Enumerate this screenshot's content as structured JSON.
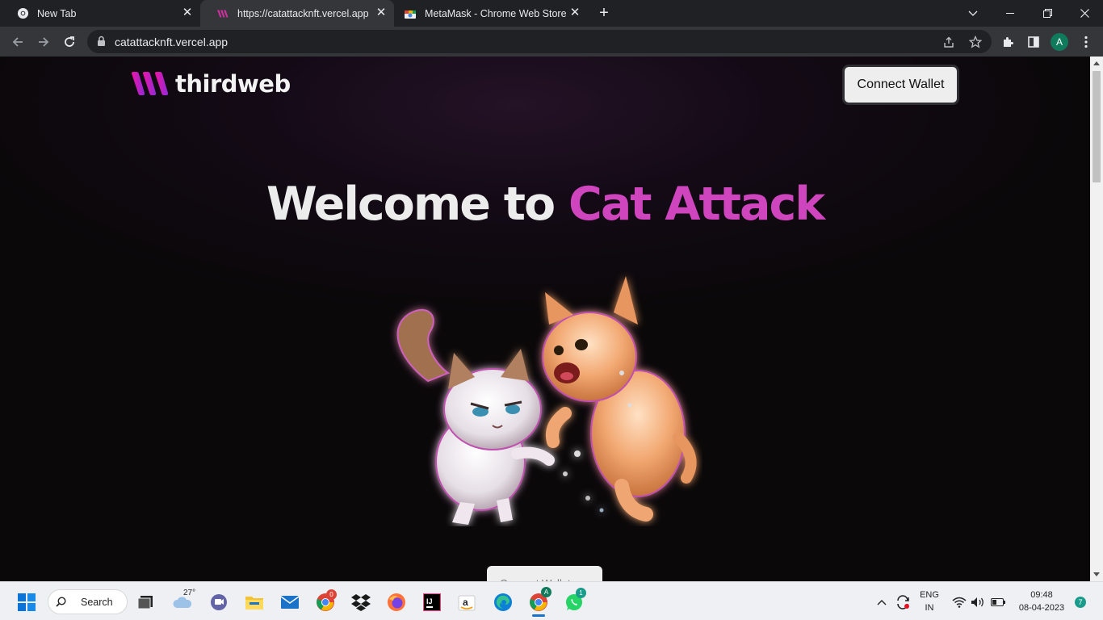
{
  "browser": {
    "tabs": [
      {
        "title": "New Tab",
        "active": false
      },
      {
        "title": "https://catattacknft.vercel.app",
        "active": true
      },
      {
        "title": "MetaMask - Chrome Web Store",
        "active": false
      }
    ],
    "address_bar": {
      "url": "catattacknft.vercel.app"
    },
    "profile_initial": "A"
  },
  "page": {
    "logo_text": "thirdweb",
    "connect_button": "Connect Wallet",
    "hero": {
      "prefix": "Welcome to ",
      "accent": "Cat Attack"
    },
    "bottom_button": "Connect Wallet",
    "colors": {
      "accent": "#cf45bd",
      "background": "#0a0809",
      "logo_gradient_start": "#e11fa0",
      "logo_gradient_end": "#8a2be2"
    }
  },
  "taskbar": {
    "search_label": "Search",
    "weather_temp": "27°",
    "chrome_profile_badge": "A",
    "whatsapp_badge": "1",
    "language": "ENG",
    "region": "IN",
    "time": "09:48",
    "date": "08-04-2023",
    "notification_count": "7"
  }
}
